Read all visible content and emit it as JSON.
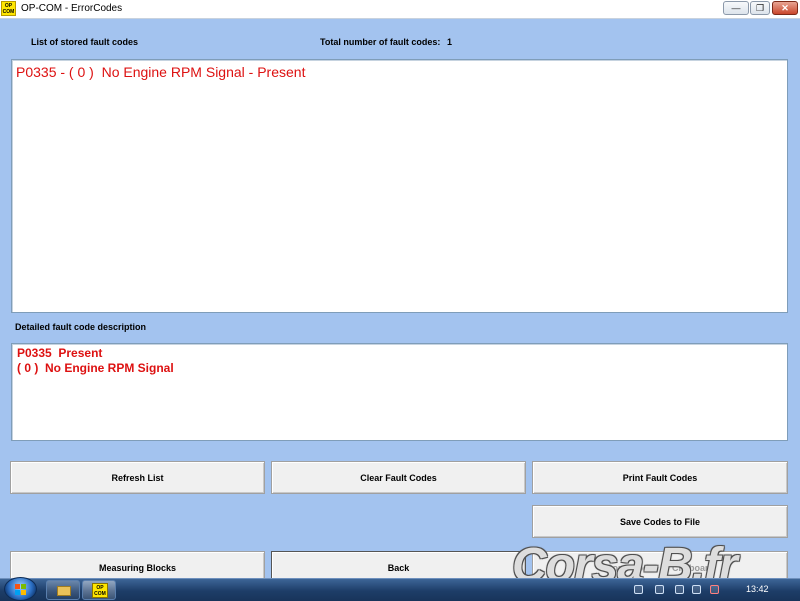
{
  "window": {
    "title": "OP-COM - ErrorCodes",
    "app_icon_text": "OP COM",
    "minimize_glyph": "—",
    "restore_glyph": "❐",
    "close_glyph": "✕"
  },
  "stored": {
    "label": "List of stored fault codes",
    "total_label": "Total number of fault codes:",
    "total_value": "1",
    "codes": [
      "P0335 - ( 0 )  No Engine RPM Signal - Present"
    ]
  },
  "detail": {
    "label": "Detailed fault code description",
    "lines": [
      "P0335  Present",
      "( 0 )  No Engine RPM Signal"
    ]
  },
  "buttons": {
    "refresh": "Refresh List",
    "clear": "Clear Fault Codes",
    "print": "Print Fault Codes",
    "save": "Save Codes to File",
    "measuring": "Measuring Blocks",
    "back": "Back",
    "copy": "Copy Codes to Clipboard"
  },
  "taskbar": {
    "op_icon_text": "OP COM",
    "clock": "13:42"
  },
  "watermark": "Corsa-B.fr",
  "colors": {
    "fault_text": "#dd1111",
    "client_bg": "#a3c3ef"
  }
}
